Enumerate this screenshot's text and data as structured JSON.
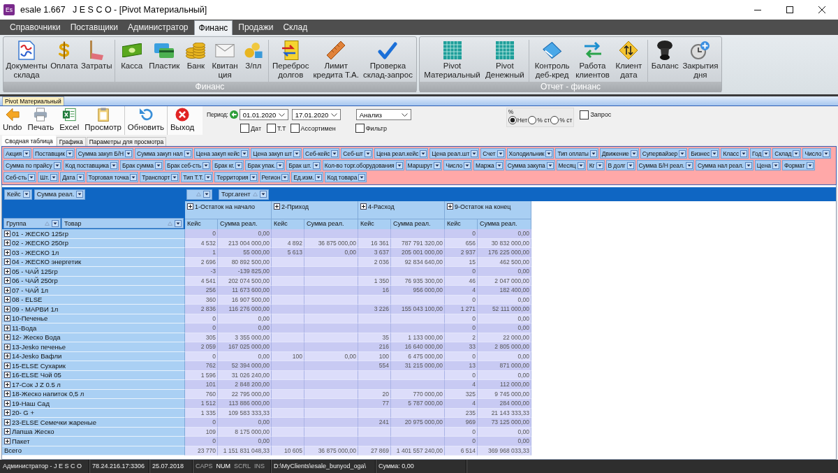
{
  "window": {
    "app_icon": "Es",
    "title": "esale 1.667   J E S C O - [Pivot Материальный]"
  },
  "menu_tabs": [
    {
      "label": "Справочники",
      "selected": false
    },
    {
      "label": "Поставщики",
      "selected": false
    },
    {
      "label": "Администратор",
      "selected": false
    },
    {
      "label": "Финанс",
      "selected": true
    },
    {
      "label": "Продажи",
      "selected": false
    },
    {
      "label": "Склад",
      "selected": false
    }
  ],
  "ribbon_groups": [
    {
      "label": "Финанс",
      "sections": [
        [
          {
            "label": "Документы\nсклада"
          },
          {
            "label": "Оплата"
          },
          {
            "label": "Затраты"
          }
        ],
        [
          {
            "label": "Касса"
          },
          {
            "label": "Пластик"
          },
          {
            "label": "Банк"
          },
          {
            "label": "Квитан\nция"
          },
          {
            "label": "З/пл"
          }
        ],
        [
          {
            "label": "Переброс\nдолгов"
          },
          {
            "label": "Лимит\nкредита Т.А."
          },
          {
            "label": "Проверка\nсклад-запрос"
          }
        ]
      ]
    },
    {
      "label": "Отчет - финанс",
      "sections": [
        [
          {
            "label": "Pivot\nМатериальный"
          },
          {
            "label": "Pivot\nДенежный"
          }
        ],
        [
          {
            "label": "Контроль\nдеб-кред"
          },
          {
            "label": "Работа\nклиентов"
          },
          {
            "label": "Клиент\nдата"
          }
        ],
        [
          {
            "label": "Баланс"
          },
          {
            "label": "Закрытия\nдня"
          }
        ]
      ]
    }
  ],
  "document_tabs": [
    {
      "label": "Pivot Материальный",
      "selected": true
    }
  ],
  "toolbar": [
    [
      {
        "label": "Undo"
      },
      {
        "label": "Печать"
      },
      {
        "label": "Excel"
      },
      {
        "label": "Просмотр"
      }
    ],
    [
      {
        "label": "Обновить"
      }
    ],
    [
      {
        "label": "Выход"
      }
    ]
  ],
  "period": {
    "label": "Период:",
    "from": "01.01.2020",
    "to": "17.01.2020"
  },
  "mode": {
    "value": "Анализ"
  },
  "options": [
    {
      "label": "Дат",
      "checked": false
    },
    {
      "label": "Т.Т",
      "checked": false
    },
    {
      "label": "Ассортимен",
      "checked": false
    }
  ],
  "filter": {
    "label": "Фильтр",
    "checked": false
  },
  "percent": {
    "label": "%",
    "options": [
      {
        "label": "Нет",
        "selected": true
      },
      {
        "label": "% ст",
        "selected": false
      },
      {
        "label": "% ст",
        "selected": false
      }
    ]
  },
  "query": {
    "label": "Запрос",
    "checked": false
  },
  "view_tabs": [
    {
      "label": "Сводная таблица",
      "selected": true
    },
    {
      "label": "Графика",
      "selected": false
    },
    {
      "label": "Параметры для просмотра",
      "selected": false
    }
  ],
  "field_list": [
    [
      "Акция",
      "Поставщик",
      "Сумма закуп Б/Н",
      "Сумма закуп нал",
      "Цена закуп кейс",
      "Цена закуп шт",
      "Себ-кейс",
      "Себ-шт",
      "Цена реал.кейс",
      "Цена реал.шт",
      "Счет",
      "Холодильник",
      "Тип оплаты",
      "Движение",
      "Супервайзер",
      "Бизнес",
      "Класс",
      "Год",
      "Склад",
      "Число"
    ],
    [
      "Сумма по прайсу",
      "Код поставщика",
      "Брак сумма",
      "Брак себ-сть",
      "Брак кг.",
      "Брак упак.",
      "Брак шт.",
      "Кол-во торг.оборудования",
      "Маршрут",
      "Число",
      "Маржа",
      "Сумма закупа",
      "Месяц",
      "Кг",
      "В долг",
      "Сумма Б/Н реал.",
      "Сумма нал реал.",
      "Цена",
      "Формат"
    ],
    [
      "Себ-сть",
      "Шт.",
      "Дата",
      "Торговая точка",
      "Транспорт",
      "Тип Т.Т.",
      "Территория",
      "Регион",
      "Ед.изм.",
      "Код товара"
    ]
  ],
  "pivot": {
    "data_fields": [
      "Кейс",
      "Сумма реал."
    ],
    "column_fields": [
      {
        "sorted": true
      },
      {
        "label": "Торг.агент",
        "sorted": true
      }
    ],
    "row_fields": [
      {
        "label": "Группа",
        "sorted": true
      },
      {
        "label": "Товар",
        "sorted": true
      }
    ],
    "column_groups": [
      {
        "label": "1-Остаток на начало",
        "expanded": false,
        "subcolumns": [
          "Кейс",
          "Сумма реал."
        ]
      },
      {
        "label": "2-Приход",
        "expanded": false,
        "subcolumns": [
          "Кейс",
          "Сумма реал."
        ]
      },
      {
        "label": "4-Расход",
        "expanded": false,
        "subcolumns": [
          "Кейс",
          "Сумма реал."
        ]
      },
      {
        "label": "9-Остаток на конец",
        "expanded": false,
        "subcolumns": [
          "Кейс",
          "Сумма реал."
        ]
      }
    ],
    "rows": [
      {
        "label": "01 - ЖЕСКО 125гр",
        "expanded": false,
        "cells": [
          "0",
          "0,00",
          null,
          null,
          null,
          null,
          "0",
          "0,00"
        ]
      },
      {
        "label": "02 - ЖЕСКО 250гр",
        "expanded": false,
        "cells": [
          "4 532",
          "213 004 000,00",
          "4 892",
          "36 875 000,00",
          "16 361",
          "787 791 320,00",
          "656",
          "30 832 000,00"
        ]
      },
      {
        "label": "03 - ЖЕСКО 1л",
        "expanded": false,
        "cells": [
          "1",
          "55 000,00",
          "5 613",
          "0,00",
          "3 637",
          "205 001 000,00",
          "2 937",
          "176 225 000,00"
        ]
      },
      {
        "label": "04 - ЖЕСКО энергетик",
        "expanded": false,
        "cells": [
          "2 696",
          "80 892 500,00",
          null,
          null,
          "2 036",
          "92 834 640,00",
          "15",
          "462 500,00"
        ]
      },
      {
        "label": "05 - ЧАЙ 125гр",
        "expanded": false,
        "cells": [
          "-3",
          "-139 825,00",
          null,
          null,
          null,
          null,
          "0",
          "0,00"
        ]
      },
      {
        "label": "06 - ЧАЙ 250гр",
        "expanded": false,
        "cells": [
          "4 541",
          "202 074 500,00",
          null,
          null,
          "1 350",
          "76 935 300,00",
          "46",
          "2 047 000,00"
        ]
      },
      {
        "label": "07 - ЧАЙ 1л",
        "expanded": false,
        "cells": [
          "256",
          "11 673 600,00",
          null,
          null,
          "16",
          "956 000,00",
          "4",
          "182 400,00"
        ]
      },
      {
        "label": "08 - ELSE",
        "expanded": false,
        "cells": [
          "360",
          "16 907 500,00",
          null,
          null,
          null,
          null,
          "0",
          "0,00"
        ]
      },
      {
        "label": "09 - МАРВИ 1л",
        "expanded": false,
        "cells": [
          "2 836",
          "116 276 000,00",
          null,
          null,
          "3 226",
          "155 043 100,00",
          "1 271",
          "52 111 000,00"
        ]
      },
      {
        "label": "10-Печенье",
        "expanded": false,
        "cells": [
          "0",
          "0,00",
          null,
          null,
          null,
          null,
          "0",
          "0,00"
        ]
      },
      {
        "label": "11-Вода",
        "expanded": false,
        "cells": [
          "0",
          "0,00",
          null,
          null,
          null,
          null,
          "0",
          "0,00"
        ]
      },
      {
        "label": "12- Жеско Вода",
        "expanded": false,
        "cells": [
          "305",
          "3 355 000,00",
          null,
          null,
          "35",
          "1 133 000,00",
          "2",
          "22 000,00"
        ]
      },
      {
        "label": "13-Jesko печенье",
        "expanded": false,
        "cells": [
          "2 059",
          "167 025 000,00",
          null,
          null,
          "216",
          "16 640 000,00",
          "33",
          "2 805 000,00"
        ]
      },
      {
        "label": "14-Jesko Вафли",
        "expanded": false,
        "cells": [
          "0",
          "0,00",
          "100",
          "0,00",
          "100",
          "6 475 000,00",
          "0",
          "0,00"
        ]
      },
      {
        "label": "15-ELSE Сухарик",
        "expanded": false,
        "cells": [
          "762",
          "52 394 000,00",
          null,
          null,
          "554",
          "31 215 000,00",
          "13",
          "871 000,00"
        ]
      },
      {
        "label": "16-ELSE Чой 05",
        "expanded": false,
        "cells": [
          "1 596",
          "31 026 240,00",
          null,
          null,
          null,
          null,
          "0",
          "0,00"
        ]
      },
      {
        "label": "17-Сок J Z 0.5 л",
        "expanded": false,
        "cells": [
          "101",
          "2 848 200,00",
          null,
          null,
          null,
          null,
          "4",
          "112 000,00"
        ]
      },
      {
        "label": "18-Жеско напиток 0,5 л",
        "expanded": false,
        "cells": [
          "760",
          "22 795 000,00",
          null,
          null,
          "20",
          "770 000,00",
          "325",
          "9 745 000,00"
        ]
      },
      {
        "label": "19-Наш Сад",
        "expanded": false,
        "cells": [
          "1 512",
          "113 886 000,00",
          null,
          null,
          "77",
          "5 787 000,00",
          "4",
          "284 000,00"
        ]
      },
      {
        "label": "20- G +",
        "expanded": false,
        "cells": [
          "1 335",
          "109 583 333,33",
          null,
          null,
          null,
          null,
          "235",
          "21 143 333,33"
        ]
      },
      {
        "label": "23-ELSE Семечки жареные",
        "expanded": false,
        "cells": [
          "0",
          "0,00",
          null,
          null,
          "241",
          "20 975 000,00",
          "969",
          "73 125 000,00"
        ]
      },
      {
        "label": "Лапша Жеско",
        "expanded": false,
        "cells": [
          "109",
          "8 175 000,00",
          null,
          null,
          null,
          null,
          "0",
          "0,00"
        ]
      },
      {
        "label": "Пакет",
        "expanded": false,
        "cells": [
          "0",
          "0,00",
          null,
          null,
          null,
          null,
          "0",
          "0,00"
        ]
      }
    ],
    "total": {
      "label": "Всего",
      "cells": [
        "23 770",
        "1 151 831 048,33",
        "10 605",
        "36 875 000,00",
        "27 869",
        "1 401 557 240,00",
        "6 514",
        "369 968 033,33"
      ]
    }
  },
  "status_bar": {
    "user": "Администратор - J E S C O",
    "server": "78.24.216.17:3306",
    "date": "25.07.2018",
    "keys": [
      {
        "label": "CAPS",
        "on": false
      },
      {
        "label": "NUM",
        "on": true
      },
      {
        "label": "SCRL",
        "on": false
      },
      {
        "label": "INS",
        "on": false
      }
    ],
    "path": "D:\\MyClients\\esale_bunyod_oga\\",
    "sum": "Сумма: 0,00"
  }
}
